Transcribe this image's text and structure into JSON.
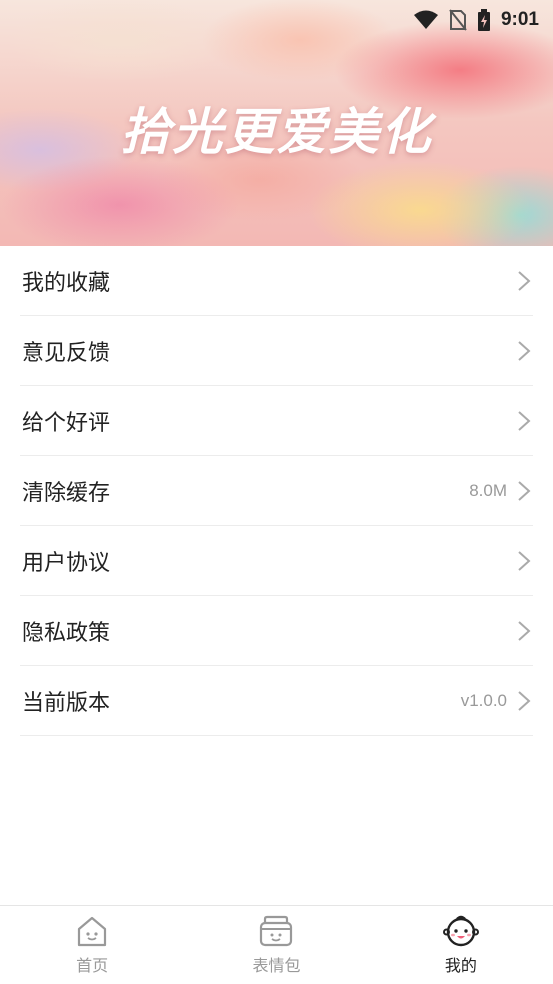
{
  "status_bar": {
    "time": "9:01"
  },
  "hero": {
    "title": "拾光更爱美化"
  },
  "menu": {
    "items": [
      {
        "label": "我的收藏",
        "value": ""
      },
      {
        "label": "意见反馈",
        "value": ""
      },
      {
        "label": "给个好评",
        "value": ""
      },
      {
        "label": "清除缓存",
        "value": "8.0M"
      },
      {
        "label": "用户协议",
        "value": ""
      },
      {
        "label": "隐私政策",
        "value": ""
      },
      {
        "label": "当前版本",
        "value": "v1.0.0"
      }
    ]
  },
  "tabbar": {
    "tabs": [
      {
        "label": "首页",
        "icon": "home-icon",
        "active": false
      },
      {
        "label": "表情包",
        "icon": "emoji-box-icon",
        "active": false
      },
      {
        "label": "我的",
        "icon": "baby-face-icon",
        "active": true
      }
    ]
  },
  "colors": {
    "accent_pink": "#f0607a",
    "text": "#222222",
    "muted": "#999999"
  }
}
